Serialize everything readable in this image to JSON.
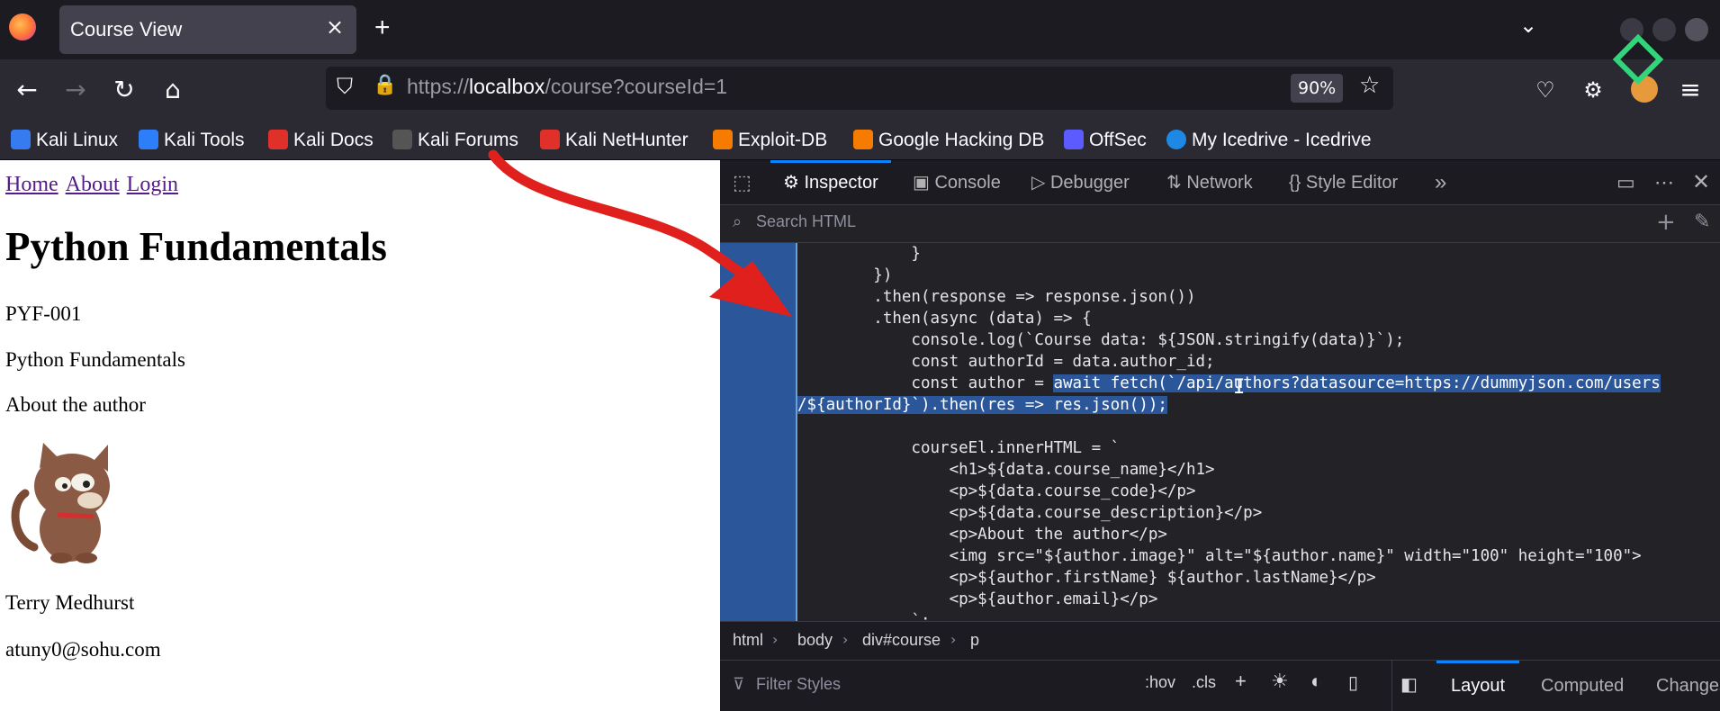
{
  "tab": {
    "title": "Course View",
    "close": "×"
  },
  "newtab": "+",
  "tablist": "⌄",
  "nav": {
    "back": "←",
    "forward": "→",
    "reload": "↻",
    "home": "⌂"
  },
  "url": {
    "scheme": "https://",
    "host": "localbox",
    "path": "/course?courseId=1",
    "zoom": "90%",
    "shield": "⛉",
    "lock": "🔒",
    "star": "☆"
  },
  "toolbar_icons": {
    "pocket": "♡",
    "extensions": "⚙",
    "menu": "≡"
  },
  "bookmarks": [
    {
      "label": "Kali Linux",
      "color": "#367bf0"
    },
    {
      "label": "Kali Tools",
      "color": "#2d7ff9"
    },
    {
      "label": "Kali Docs",
      "color": "#e0302a"
    },
    {
      "label": "Kali Forums",
      "color": "#555555"
    },
    {
      "label": "Kali NetHunter",
      "color": "#e0302a"
    },
    {
      "label": "Exploit-DB",
      "color": "#f57c00"
    },
    {
      "label": "Google Hacking DB",
      "color": "#f57c00"
    },
    {
      "label": "OffSec",
      "color": "#5b5bff"
    },
    {
      "label": "My Icedrive - Icedrive",
      "color": "#1e88e5"
    }
  ],
  "page": {
    "nav": [
      "Home",
      "About",
      "Login"
    ],
    "title": "Python Fundamentals",
    "code": "PYF-001",
    "description": "Python Fundamentals",
    "about": "About the author",
    "author_name": "Terry Medhurst",
    "author_email": "atuny0@sohu.com"
  },
  "devtools": {
    "tabs": [
      "Inspector",
      "Console",
      "Debugger",
      "Network",
      "Style Editor"
    ],
    "active_tab": "Inspector",
    "more": "»",
    "search_placeholder": "Search HTML",
    "code_lines": [
      "            }",
      "        })",
      "        .then(response => response.json())",
      "        .then(async (data) => {",
      "            console.log(`Course data: ${JSON.stringify(data)}`);",
      "            const authorId = data.author_id;",
      "            const author = ",
      "",
      "",
      "            courseEl.innerHTML = `",
      "                <h1>${data.course_name}</h1>",
      "                <p>${data.course_code}</p>",
      "                <p>${data.course_description}</p>",
      "                <p>About the author</p>",
      "                <img src=\"${author.image}\" alt=\"${author.name}\" width=\"100\" height=\"100\">",
      "                <p>${author.firstName} ${author.lastName}</p>",
      "                <p>${author.email}</p>",
      "            `;"
    ],
    "selected_part1": "await fetch(`/api/authors?datasource=https://dummyjson.com/users",
    "selected_part2": "/${authorId}`).then(res => res.json());",
    "breadcrumbs": [
      "html",
      "body",
      "div#course",
      "p"
    ],
    "filter_placeholder": "Filter Styles",
    "hov": ":hov",
    "cls": ".cls",
    "right_tabs": [
      "Layout",
      "Computed",
      "Changes"
    ],
    "active_right_tab": "Layout"
  },
  "colors": {
    "accent": "#0a84ff",
    "selection": "#2b579a",
    "annotation_arrow": "#e0201c"
  }
}
